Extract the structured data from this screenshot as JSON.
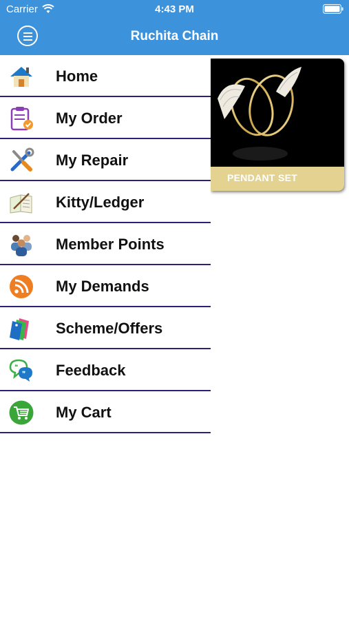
{
  "status_bar": {
    "carrier": "Carrier",
    "time": "4:43 PM"
  },
  "header": {
    "title": "Ruchita Chain",
    "color": "#3d92dc"
  },
  "menu": {
    "items": [
      {
        "label": "Home",
        "icon": "home-icon"
      },
      {
        "label": "My Order",
        "icon": "clipboard-icon"
      },
      {
        "label": "My Repair",
        "icon": "tools-icon"
      },
      {
        "label": "Kitty/Ledger",
        "icon": "ledger-icon"
      },
      {
        "label": "Member Points",
        "icon": "members-icon"
      },
      {
        "label": "My Demands",
        "icon": "rss-icon"
      },
      {
        "label": "Scheme/Offers",
        "icon": "tags-icon"
      },
      {
        "label": "Feedback",
        "icon": "chat-bubbles-icon"
      },
      {
        "label": "My Cart",
        "icon": "cart-icon"
      }
    ],
    "divider_color": "#2b2278"
  },
  "banner": {
    "caption": "PENDANT SET",
    "caption_color": "#e3d290"
  }
}
